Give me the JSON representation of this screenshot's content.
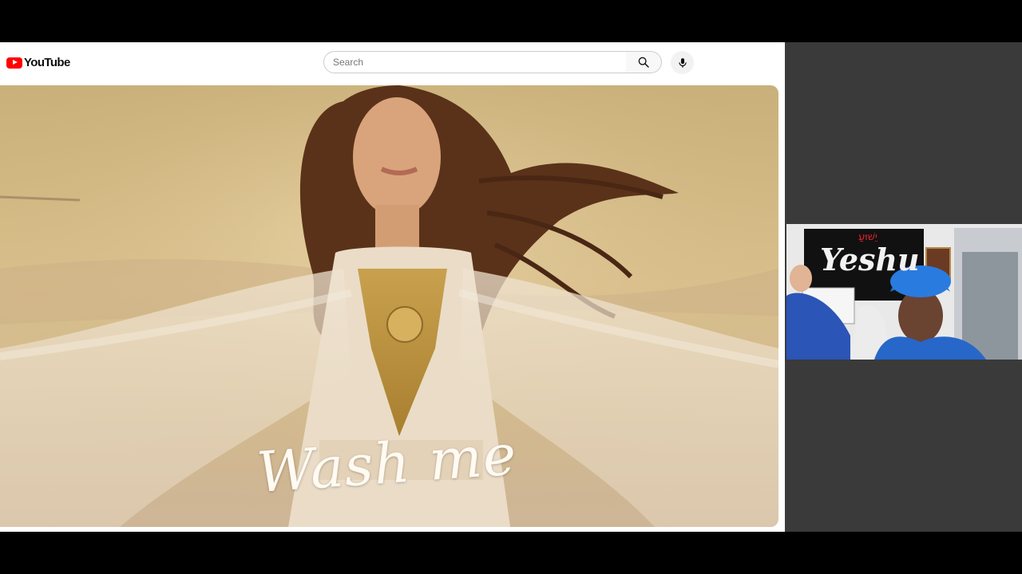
{
  "masthead": {
    "logo_text": "YouTube",
    "search_placeholder": "Search",
    "search_button_icon": "search-icon",
    "mic_button_icon": "microphone-icon"
  },
  "video": {
    "title_overlay": "Wash me"
  },
  "webcam": {
    "banner_text": "Yeshu",
    "banner_hebrew": "יֵשׁוּעַ"
  },
  "colors": {
    "brand_red": "#ff0000",
    "page_bg": "#ffffff",
    "letterbox": "#000000",
    "side_panel": "#3a3a3a"
  }
}
